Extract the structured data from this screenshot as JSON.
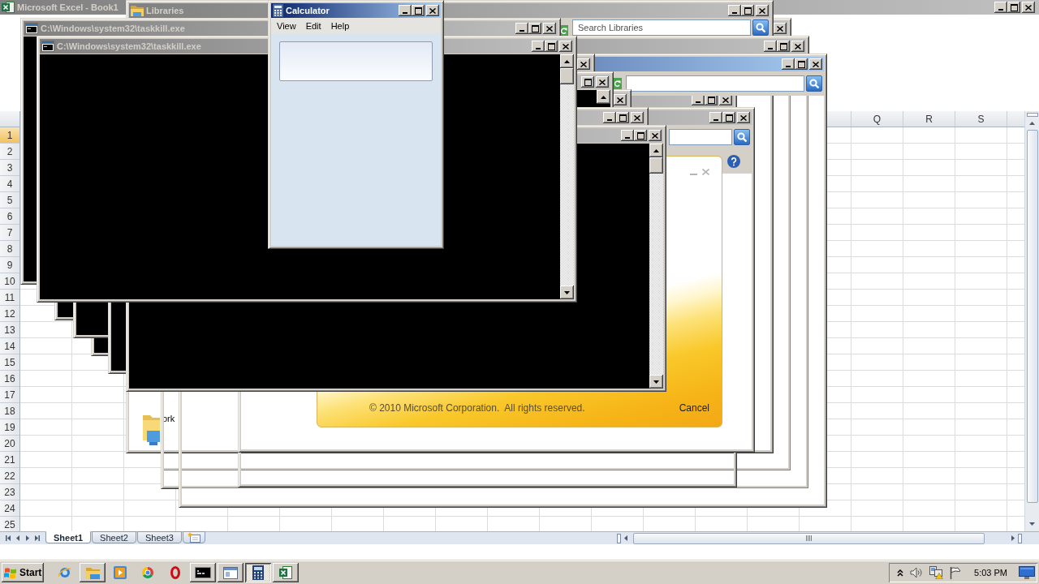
{
  "excel": {
    "title": "Microsoft Excel - Book1",
    "active": false,
    "columns": [
      "Q",
      "R",
      "S"
    ],
    "rows": [
      {
        "label": "1",
        "selected": true
      },
      {
        "label": "2",
        "selected": false
      },
      {
        "label": "3",
        "selected": false
      },
      {
        "label": "4",
        "selected": false
      },
      {
        "label": "5",
        "selected": false
      },
      {
        "label": "6",
        "selected": false
      },
      {
        "label": "7",
        "selected": false
      },
      {
        "label": "8",
        "selected": false
      },
      {
        "label": "9",
        "selected": false
      },
      {
        "label": "10",
        "selected": false
      },
      {
        "label": "11",
        "selected": false
      },
      {
        "label": "12",
        "selected": false
      },
      {
        "label": "13",
        "selected": false
      },
      {
        "label": "14",
        "selected": false
      },
      {
        "label": "15",
        "selected": false
      },
      {
        "label": "16",
        "selected": false
      },
      {
        "label": "17",
        "selected": false
      },
      {
        "label": "18",
        "selected": false
      },
      {
        "label": "19",
        "selected": false
      },
      {
        "label": "20",
        "selected": false
      },
      {
        "label": "21",
        "selected": false
      },
      {
        "label": "22",
        "selected": false
      },
      {
        "label": "23",
        "selected": false
      },
      {
        "label": "24",
        "selected": false
      },
      {
        "label": "25",
        "selected": false
      }
    ],
    "sheet_tabs": [
      {
        "label": "Sheet1",
        "selected": true
      },
      {
        "label": "Sheet2",
        "selected": false
      },
      {
        "label": "Sheet3",
        "selected": false
      }
    ]
  },
  "explorer_windows": [
    {
      "title": "Libraries",
      "active": false,
      "search": {
        "placeholder": "Search Libraries"
      },
      "nav_items": [
        "ork"
      ]
    },
    {
      "active": false
    },
    {
      "active": false
    },
    {
      "active": true
    },
    {
      "active": false
    },
    {
      "active": false
    }
  ],
  "office_splash": {
    "copyright": "© 2010 Microsoft Corporation.  All rights reserved.",
    "cancel": "Cancel"
  },
  "console_windows": [
    {
      "title": "C:\\Windows\\system32\\taskkill.exe",
      "active": false
    },
    {
      "title": "C:\\Windows\\system32\\taskkill.exe",
      "active": false
    },
    {
      "active": false
    },
    {
      "active": false
    },
    {
      "active": false
    },
    {
      "active": false
    },
    {
      "active": false
    }
  ],
  "calculator": {
    "title": "Calculator",
    "active": true,
    "menu": [
      "View",
      "Edit",
      "Help"
    ]
  },
  "taskbar": {
    "start": "Start",
    "buttons": [
      {
        "kind": "pinned",
        "selected": false
      },
      {
        "kind": "task",
        "selected": false
      },
      {
        "kind": "pinned",
        "selected": false
      },
      {
        "kind": "pinned",
        "selected": false
      },
      {
        "kind": "pinned",
        "selected": false
      },
      {
        "kind": "task",
        "selected": false
      },
      {
        "kind": "task",
        "selected": false
      },
      {
        "kind": "task",
        "selected": true
      },
      {
        "kind": "task",
        "selected": false
      }
    ],
    "clock": "5:03 PM"
  }
}
